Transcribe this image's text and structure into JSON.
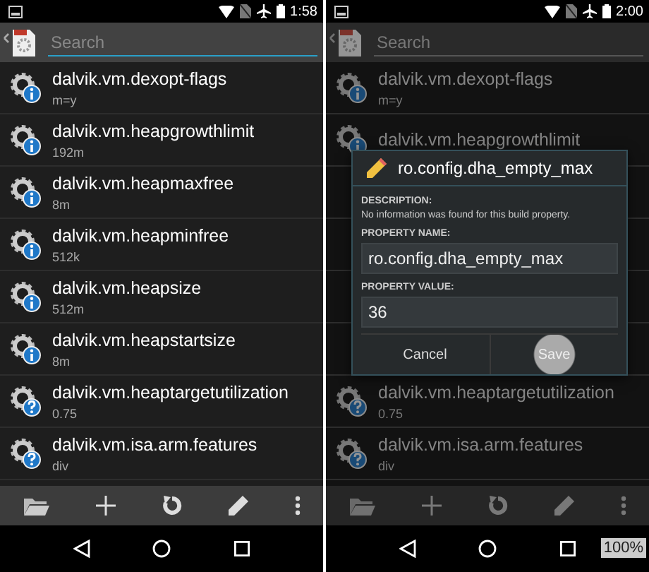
{
  "screens": [
    {
      "status_bar": {
        "time": "1:58"
      },
      "search": {
        "placeholder": "Search",
        "focused": true
      },
      "dimmed": false,
      "items": [
        {
          "kind": "info",
          "name": "dalvik.vm.dexopt-flags",
          "value": "m=y"
        },
        {
          "kind": "info",
          "name": "dalvik.vm.heapgrowthlimit",
          "value": "192m"
        },
        {
          "kind": "info",
          "name": "dalvik.vm.heapmaxfree",
          "value": "8m"
        },
        {
          "kind": "info",
          "name": "dalvik.vm.heapminfree",
          "value": "512k"
        },
        {
          "kind": "info",
          "name": "dalvik.vm.heapsize",
          "value": "512m"
        },
        {
          "kind": "info",
          "name": "dalvik.vm.heapstartsize",
          "value": "8m"
        },
        {
          "kind": "help",
          "name": "dalvik.vm.heaptargetutilization",
          "value": "0.75"
        },
        {
          "kind": "help",
          "name": "dalvik.vm.isa.arm.features",
          "value": "div"
        }
      ]
    },
    {
      "status_bar": {
        "time": "2:00"
      },
      "search": {
        "placeholder": "Search",
        "focused": false
      },
      "dimmed": true,
      "items": [
        {
          "kind": "info",
          "name": "dalvik.vm.dexopt-flags",
          "value": "m=y"
        },
        {
          "kind": "info",
          "name": "dalvik.vm.heapgrowthlimit"
        },
        {
          "kind": "covered"
        },
        {
          "kind": "covered"
        },
        {
          "kind": "covered"
        },
        {
          "kind": "covered"
        },
        {
          "kind": "help",
          "name": "dalvik.vm.heaptargetutilization",
          "value": "0.75"
        },
        {
          "kind": "help",
          "name": "dalvik.vm.isa.arm.features",
          "value": "div"
        }
      ],
      "dialog": {
        "title": "ro.config.dha_empty_max",
        "description_label": "DESCRIPTION:",
        "description": "No information was found for this build property.",
        "name_label": "PROPERTY NAME:",
        "name_value": "ro.config.dha_empty_max",
        "value_label": "PROPERTY VALUE:",
        "value": "36",
        "buttons": [
          {
            "label": "Cancel",
            "pressed": false
          },
          {
            "label": "Save",
            "pressed": true
          }
        ]
      },
      "zoom_badge": "100%"
    }
  ]
}
